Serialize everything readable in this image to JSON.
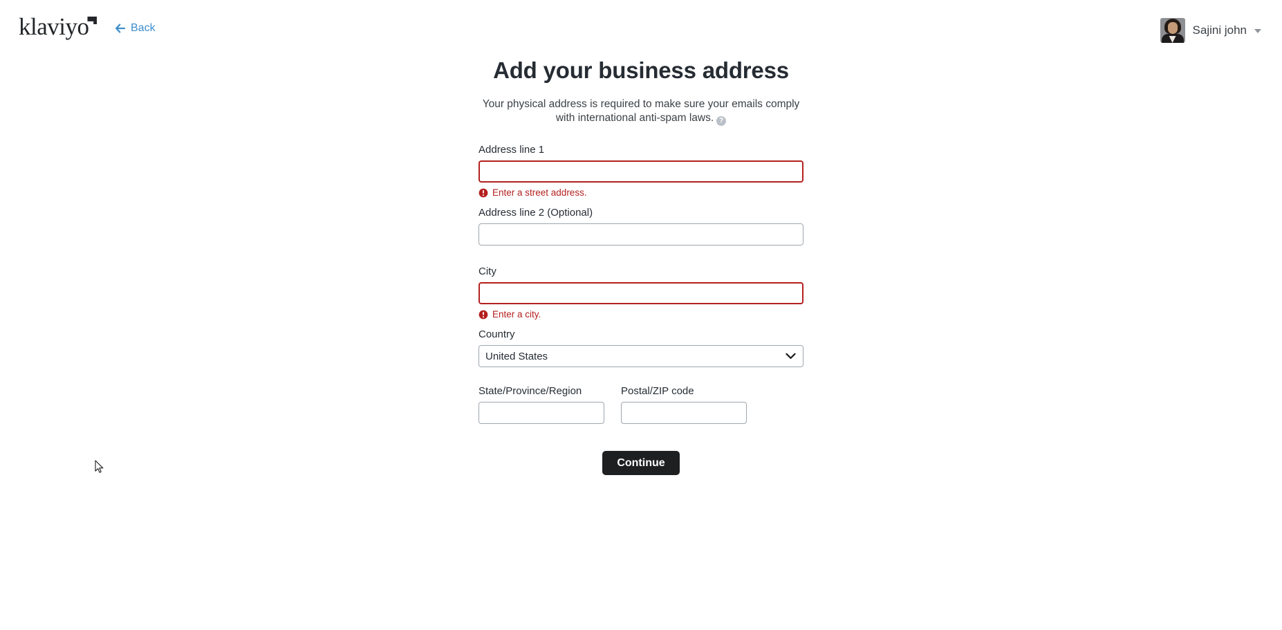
{
  "header": {
    "logo_text": "klaviyo",
    "logo_icon": "klaviyo-flag-mark",
    "back_label": "Back",
    "back_icon": "arrow-left-icon",
    "user_name": "Sajini john",
    "avatar_icon": "user-avatar-photo",
    "caret_icon": "chevron-down-icon"
  },
  "main": {
    "title": "Add your business address",
    "subtitle": "Your physical address is required to make sure your emails comply with international anti-spam laws.",
    "help_icon": "question-mark-circle-icon",
    "help_glyph": "?"
  },
  "form": {
    "address1": {
      "label": "Address line 1",
      "value": "",
      "placeholder": "",
      "error": "Enter a street address.",
      "error_icon": "exclamation-circle-icon",
      "has_error": true
    },
    "address2": {
      "label": "Address line 2 (Optional)",
      "value": "",
      "placeholder": "",
      "has_error": false
    },
    "city": {
      "label": "City",
      "value": "",
      "placeholder": "",
      "error": "Enter a city.",
      "error_icon": "exclamation-circle-icon",
      "has_error": true
    },
    "country": {
      "label": "Country",
      "selected": "United States",
      "chevron_icon": "chevron-down-icon"
    },
    "state": {
      "label": "State/Province/Region",
      "value": "",
      "placeholder": ""
    },
    "postal": {
      "label": "Postal/ZIP code",
      "value": "",
      "placeholder": ""
    },
    "submit_label": "Continue"
  },
  "colors": {
    "link_blue": "#3d8ecc",
    "error_red": "#b3201f",
    "button_dark": "#1d1f20",
    "text_dark": "#262c33",
    "border_grey": "#9fa6ad"
  },
  "cursor": {
    "icon": "mouse-pointer-arrow"
  }
}
